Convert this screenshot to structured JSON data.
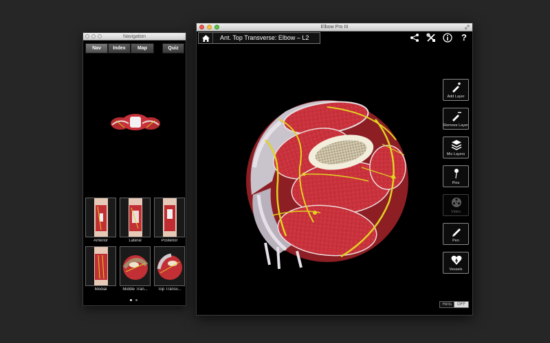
{
  "navigation": {
    "title": "Navigation",
    "tabs": [
      {
        "label": "Nav"
      },
      {
        "label": "Index"
      },
      {
        "label": "Map"
      },
      {
        "label": "Quiz"
      }
    ],
    "views": [
      {
        "label": "Anterior"
      },
      {
        "label": "Lateral"
      },
      {
        "label": "Posterior"
      },
      {
        "label": "Medial"
      },
      {
        "label": "Middle Tran..."
      },
      {
        "label": "Top Transv..."
      }
    ],
    "pages": {
      "count": 2,
      "current": 1
    }
  },
  "main": {
    "title": "Elbow Pro III",
    "breadcrumb": "Ant. Top Transverse: Elbow – L2",
    "top_icons": [
      "share-icon",
      "tools-icon",
      "info-icon",
      "help-icon"
    ],
    "help_glyph": "?",
    "tools": [
      {
        "label": "Add Layer",
        "icon": "add-layer-icon",
        "enabled": true
      },
      {
        "label": "Remove Layer",
        "icon": "remove-layer-icon",
        "enabled": true
      },
      {
        "label": "Mix Layers",
        "icon": "layers-icon",
        "enabled": true
      },
      {
        "label": "Pins",
        "icon": "pin-icon",
        "enabled": true
      },
      {
        "label": "Video",
        "icon": "film-reel-icon",
        "enabled": false
      },
      {
        "label": "Pen",
        "icon": "pen-icon",
        "enabled": true
      },
      {
        "label": "Vessels",
        "icon": "heart-icon",
        "enabled": true
      }
    ],
    "hints": {
      "label": "Hints",
      "state": "OFF"
    }
  },
  "colors": {
    "muscle": "#c8303a",
    "nerve": "#e0d020",
    "bone": "#e9e2c8",
    "background": "#262626"
  }
}
